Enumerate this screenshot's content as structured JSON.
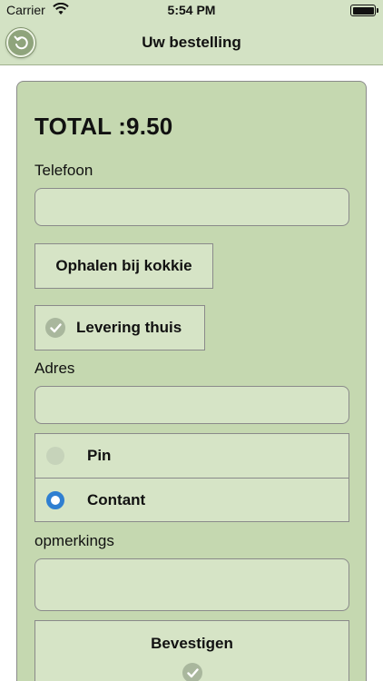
{
  "status_bar": {
    "carrier": "Carrier",
    "time": "5:54 PM",
    "icons": [
      "wifi-icon",
      "battery-icon"
    ]
  },
  "nav": {
    "title": "Uw bestelling",
    "back_icon": "undo-arrow-icon"
  },
  "order": {
    "total": "TOTAL :9.50",
    "phone_label": "Telefoon",
    "phone_value": "",
    "pickup_label": "Ophalen bij kokkie",
    "delivery_label": "Levering thuis",
    "delivery_checked": true,
    "address_label": "Adres",
    "address_value": "",
    "payment_options": [
      {
        "label": "Pin",
        "selected": false
      },
      {
        "label": "Contant",
        "selected": true
      }
    ],
    "remarks_label": "opmerkings",
    "remarks_value": "",
    "confirm_label": "Bevestigen"
  },
  "colors": {
    "bar": "#d3e2c4",
    "card": "#c5d8b0",
    "field": "#d6e4c6",
    "radio_selected": "#2f7fd1"
  }
}
